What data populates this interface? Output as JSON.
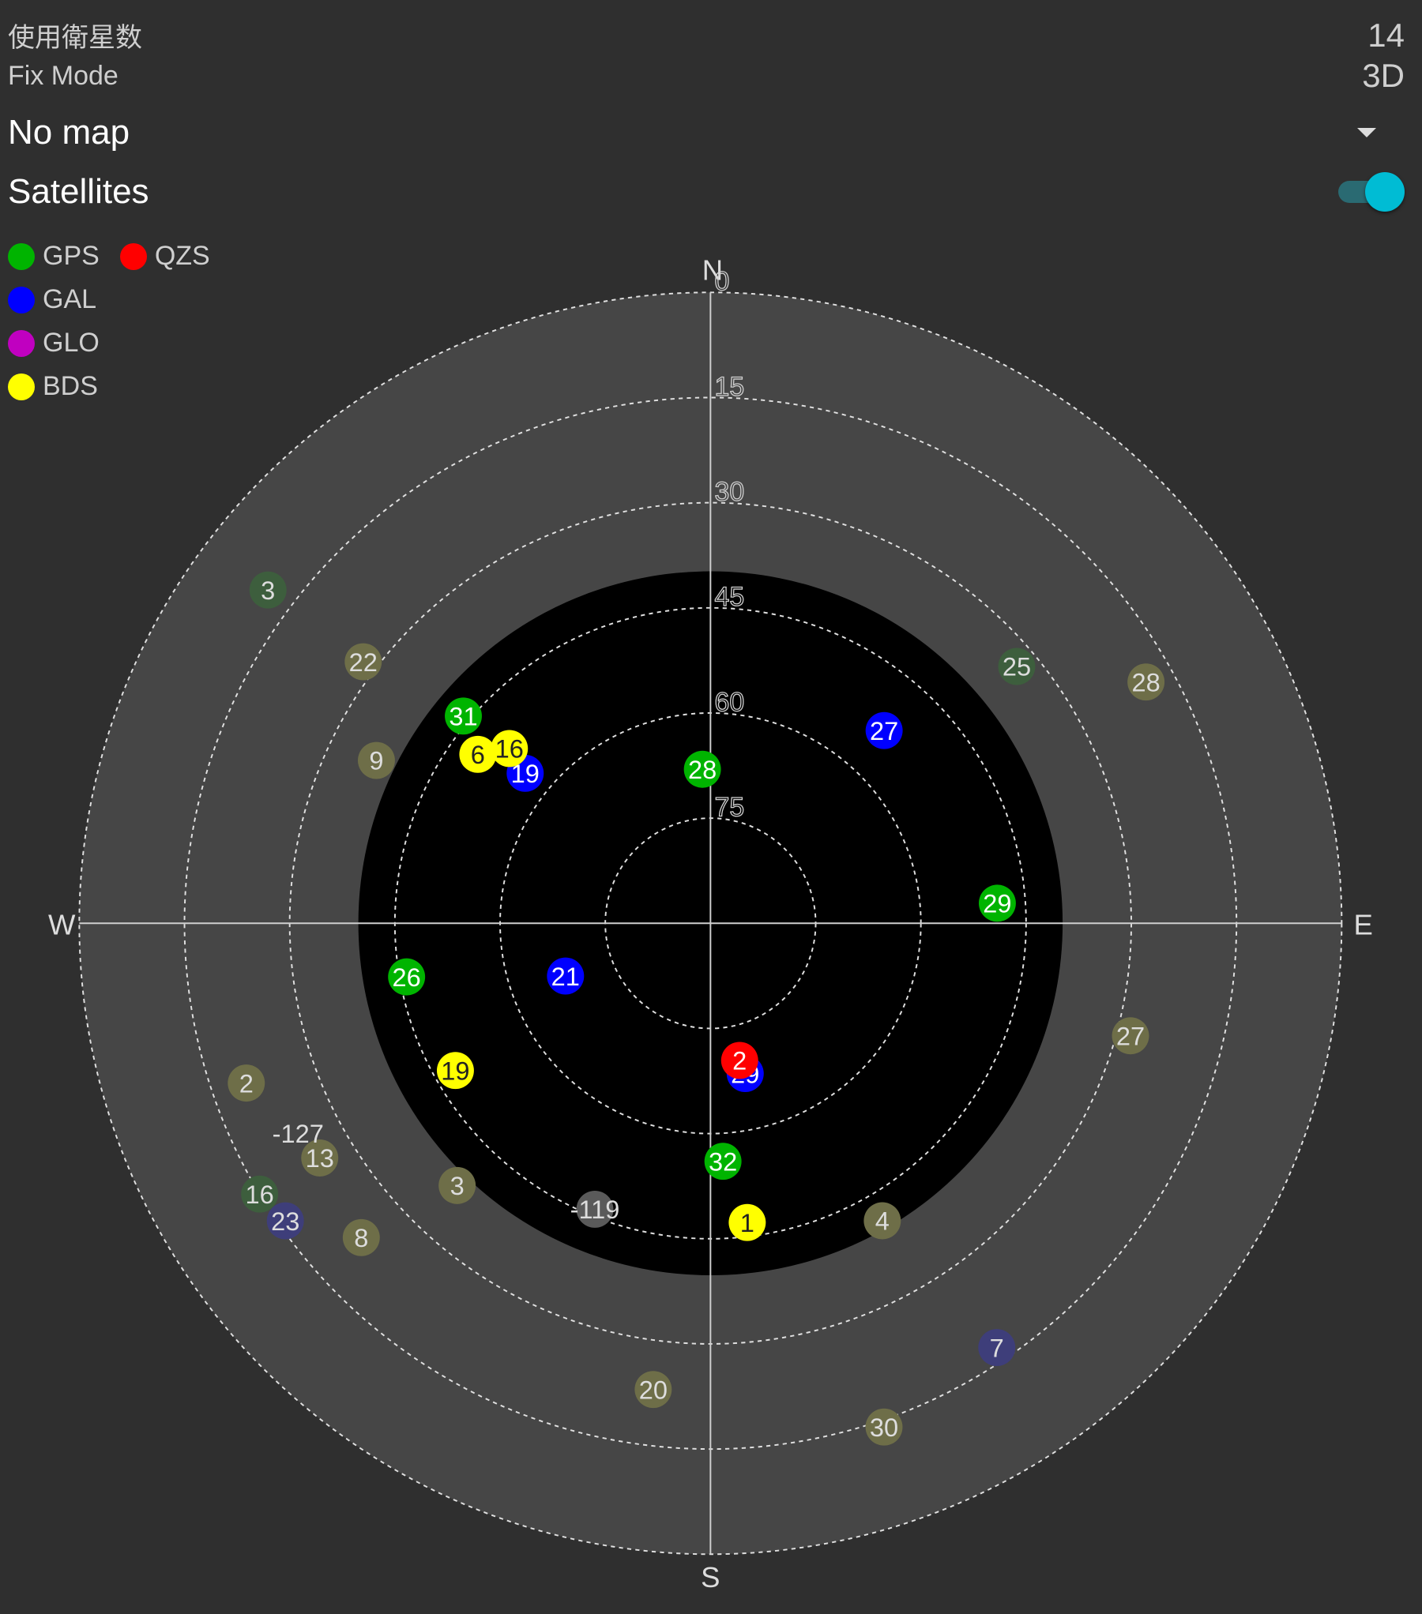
{
  "status": {
    "satellites_used_label": "使用衛星数",
    "satellites_used_value": "14",
    "fix_mode_label": "Fix Mode",
    "fix_mode_value": "3D"
  },
  "map_select": {
    "selected": "No map",
    "icon": "dropdown-triangle-icon"
  },
  "satellites_toggle": {
    "label": "Satellites",
    "on": true,
    "accent": "#00bcd4"
  },
  "legend": [
    {
      "name": "GPS",
      "color": "#00b400"
    },
    {
      "name": "QZS",
      "color": "#ff0000"
    },
    {
      "name": "GAL",
      "color": "#0000ff"
    },
    {
      "name": "GLO",
      "color": "#c000c0"
    },
    {
      "name": "BDS",
      "color": "#ffff00"
    }
  ],
  "chart_data": {
    "type": "polar-scatter",
    "title": "Satellite sky plot",
    "directions": {
      "n": "N",
      "e": "E",
      "s": "S",
      "w": "W"
    },
    "elevation_ticks": [
      "0",
      "15",
      "30",
      "45",
      "60",
      "75"
    ],
    "elevation_values": [
      0,
      15,
      30,
      45,
      60,
      75
    ],
    "constellation_colors": {
      "GPS": {
        "used": "#00b400",
        "unused": "#3d5e3d"
      },
      "GAL": {
        "used": "#0000ff",
        "unused": "#3e3e7a"
      },
      "QZS": {
        "used": "#ff0000",
        "unused": "#6e3a3a"
      },
      "GLO": {
        "used": "#c000c0",
        "unused": "#6a3a6a"
      },
      "BDS": {
        "used": "#ffff00",
        "unused": "#6e6e48"
      },
      "UNKNOWN": {
        "used": "#5a5a5a",
        "unused": "#5a5a5a"
      }
    },
    "satellites": [
      {
        "id": "31",
        "system": "GPS",
        "used": true,
        "azimuth": 310,
        "elevation": 44
      },
      {
        "id": "28",
        "system": "GPS",
        "used": true,
        "azimuth": 357,
        "elevation": 68
      },
      {
        "id": "29",
        "system": "GPS",
        "used": true,
        "azimuth": 86,
        "elevation": 49
      },
      {
        "id": "26",
        "system": "GPS",
        "used": true,
        "azimuth": 260,
        "elevation": 46
      },
      {
        "id": "32",
        "system": "GPS",
        "used": true,
        "azimuth": 177,
        "elevation": 56
      },
      {
        "id": "27",
        "system": "GAL",
        "used": true,
        "azimuth": 42,
        "elevation": 53
      },
      {
        "id": "19",
        "system": "GAL",
        "used": true,
        "azimuth": 309,
        "elevation": 56
      },
      {
        "id": "21",
        "system": "GAL",
        "used": true,
        "azimuth": 250,
        "elevation": 68
      },
      {
        "id": "29",
        "system": "GAL",
        "used": true,
        "azimuth": 167,
        "elevation": 68
      },
      {
        "id": "2",
        "system": "QZS",
        "used": true,
        "azimuth": 168,
        "elevation": 70
      },
      {
        "id": "6",
        "system": "BDS",
        "used": true,
        "azimuth": 306,
        "elevation": 49
      },
      {
        "id": "16",
        "system": "BDS",
        "used": true,
        "azimuth": 311,
        "elevation": 52
      },
      {
        "id": "19",
        "system": "BDS",
        "used": true,
        "azimuth": 240,
        "elevation": 48
      },
      {
        "id": "1",
        "system": "BDS",
        "used": true,
        "azimuth": 173,
        "elevation": 47
      },
      {
        "id": "3",
        "system": "GPS",
        "used": false,
        "azimuth": 307,
        "elevation": 11
      },
      {
        "id": "25",
        "system": "GPS",
        "used": false,
        "azimuth": 50,
        "elevation": 33
      },
      {
        "id": "16",
        "system": "GPS",
        "used": false,
        "azimuth": 239,
        "elevation": 15
      },
      {
        "id": "22",
        "system": "BDS",
        "used": false,
        "azimuth": 307,
        "elevation": 28
      },
      {
        "id": "9",
        "system": "BDS",
        "used": false,
        "azimuth": 296,
        "elevation": 37
      },
      {
        "id": "28",
        "system": "BDS",
        "used": false,
        "azimuth": 61,
        "elevation": 19
      },
      {
        "id": "27",
        "system": "BDS",
        "used": false,
        "azimuth": 105,
        "elevation": 28
      },
      {
        "id": "2",
        "system": "BDS",
        "used": false,
        "azimuth": 251,
        "elevation": 20
      },
      {
        "id": "13",
        "system": "BDS",
        "used": false,
        "azimuth": 239,
        "elevation": 25
      },
      {
        "id": "3",
        "system": "BDS",
        "used": false,
        "azimuth": 224,
        "elevation": 38
      },
      {
        "id": "8",
        "system": "BDS",
        "used": false,
        "azimuth": 228,
        "elevation": 23
      },
      {
        "id": "4",
        "system": "BDS",
        "used": false,
        "azimuth": 150,
        "elevation": 41
      },
      {
        "id": "20",
        "system": "BDS",
        "used": false,
        "azimuth": 187,
        "elevation": 23
      },
      {
        "id": "30",
        "system": "BDS",
        "used": false,
        "azimuth": 161,
        "elevation": 14
      },
      {
        "id": "23",
        "system": "GAL",
        "used": false,
        "azimuth": 235,
        "elevation": 16
      },
      {
        "id": "7",
        "system": "GAL",
        "used": false,
        "azimuth": 146,
        "elevation": 17
      },
      {
        "id": "-119",
        "system": "UNKNOWN",
        "used": false,
        "azimuth": 202,
        "elevation": 46
      },
      {
        "id": "-127",
        "system": "UNKNOWN",
        "used": false,
        "azimuth": 243,
        "elevation": 24,
        "no_marker": true
      }
    ]
  }
}
